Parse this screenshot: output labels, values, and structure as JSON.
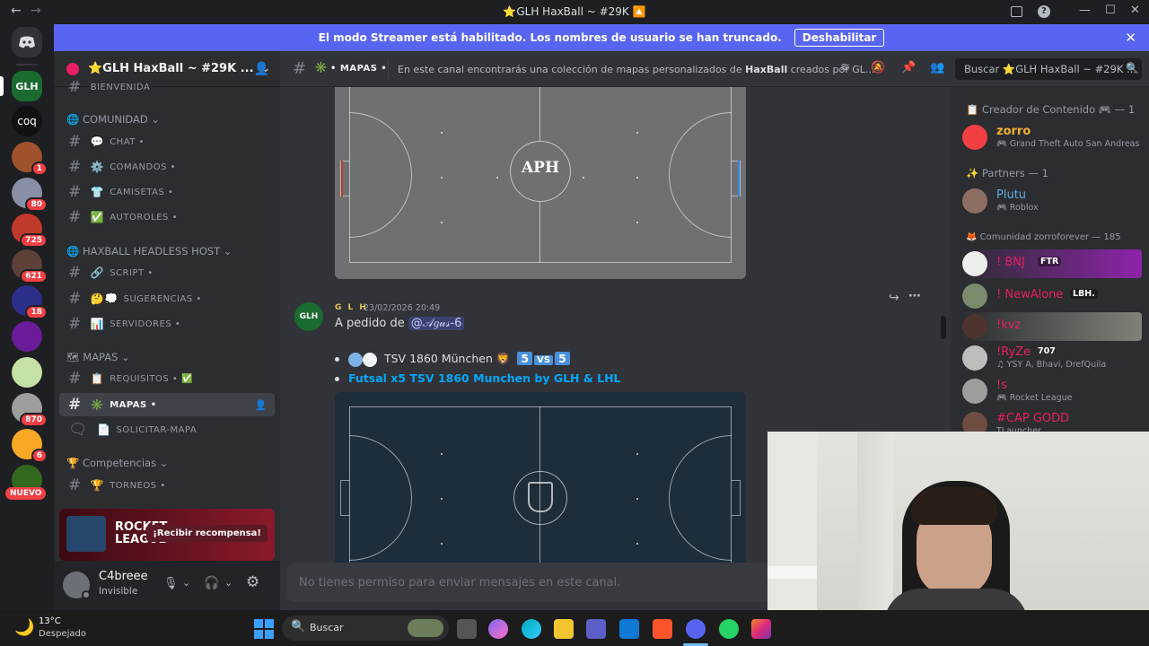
{
  "window": {
    "title": "⭐GLH HaxBall ~ #29K 🔼",
    "back": "←",
    "forward": "→",
    "minimize": "—",
    "maximize": "☐",
    "close": "✕"
  },
  "rail": {
    "servers": [
      {
        "label": "",
        "badge": ""
      },
      {
        "label": "GLH",
        "badge": ""
      },
      {
        "label": "coq",
        "badge": ""
      },
      {
        "label": "",
        "badge": "1"
      },
      {
        "label": "",
        "badge": "80"
      },
      {
        "label": "",
        "badge": "725"
      },
      {
        "label": "",
        "badge": "621"
      },
      {
        "label": "",
        "badge": "18"
      },
      {
        "label": "",
        "badge": ""
      },
      {
        "label": "",
        "badge": ""
      },
      {
        "label": "",
        "badge": "870"
      },
      {
        "label": "",
        "badge": "6"
      }
    ],
    "new_label": "NUEVO"
  },
  "banner": {
    "text": "El modo Streamer está habilitado. Los nombres de usuario se han truncado.",
    "button": "Deshabilitar"
  },
  "server": {
    "name": "⭐GLH HaxBall ~ #29K ...",
    "chevron": "⌄"
  },
  "sidebar": {
    "partial_channel": "BIENVENIDA",
    "categories": [
      "COMUNIDAD",
      "HAXBALL HEADLESS HOST",
      "MAPAS",
      "Competencias"
    ],
    "channels": [
      {
        "emoji": "💬",
        "name": "CHAT"
      },
      {
        "emoji": "⚙️",
        "name": "COMANDOS"
      },
      {
        "emoji": "👕",
        "name": "CAMISETAS"
      },
      {
        "emoji": "✅",
        "name": "AUTOROLES"
      },
      {
        "emoji": "🔗",
        "name": "SCRIPT"
      },
      {
        "emoji": "🤔💭",
        "name": "SUGERENCIAS"
      },
      {
        "emoji": "📊",
        "name": "SERVIDORES"
      },
      {
        "emoji": "📋",
        "name": "REQUISITOS",
        "suffix": "✅"
      },
      {
        "emoji": "✳️",
        "name": "MAPAS"
      },
      {
        "emoji": "📄",
        "name": "SOLICITAR-MAPA"
      },
      {
        "emoji": "🏆",
        "name": "TORNEOS"
      }
    ],
    "promo": {
      "brand_line1": "ROCKET",
      "brand_line2": "LEAGUE",
      "cta": "¡Recibir recompensa!"
    },
    "user": {
      "name": "C4breee",
      "status": "Invisible"
    }
  },
  "topbar": {
    "channel": "MAPAS",
    "topic_before": "En este canal encontrarás una colección de mapas personalizados de ",
    "topic_bold": "HaxBall",
    "topic_after": " creados por GL...",
    "search_placeholder": "Buscar ⭐GLH HaxBall ~ #29K ..."
  },
  "messages": {
    "author": "G L H",
    "timestamp": "23/02/2026 20:49",
    "text_prefix": "A pedido de ",
    "mention": "@𝒜𝑔𝓊𝓈-6",
    "item1": "TSV 1860 München 🦁",
    "vs": [
      "5",
      "VS",
      "5"
    ],
    "item2": "Futsal x5 TSV 1860 Munchen by GLH & LHL",
    "field1_logo": "APH",
    "input_placeholder": "No tienes permiso para enviar mensajes en este canal."
  },
  "members": {
    "groups": [
      {
        "title": "Creador de Contenido 🎮 — 1"
      },
      {
        "title": "Partners — 1"
      },
      {
        "title": "Comunidad zorroforever — 185"
      }
    ],
    "list": [
      {
        "name": "zorro",
        "activity": "🎮 Grand Theft Auto San Andreas",
        "color": "#f0b232"
      },
      {
        "name": "Plutu",
        "activity": "🎮 Roblox",
        "color": "#5dade2"
      },
      {
        "name": "! BNJ",
        "tag": "FTR",
        "activity": "",
        "color": "#e91e63"
      },
      {
        "name": "! NewAlone",
        "tag": "LBH.",
        "activity": "",
        "color": "#e91e63"
      },
      {
        "name": "!kvz",
        "activity": "",
        "color": "#e91e63"
      },
      {
        "name": "!RyZe",
        "tag": "707",
        "activity": "♫ YSY A, Bhavi, DrefQuila",
        "color": "#e91e63"
      },
      {
        "name": "!s",
        "activity": "🎮 Rocket League",
        "color": "#e91e63"
      },
      {
        "name": "#CAP GODD",
        "activity": "TLauncher",
        "color": "#e91e63"
      }
    ]
  },
  "taskbar": {
    "weather_temp": "13°C",
    "weather_desc": "Despejado",
    "search_label": "Buscar"
  }
}
